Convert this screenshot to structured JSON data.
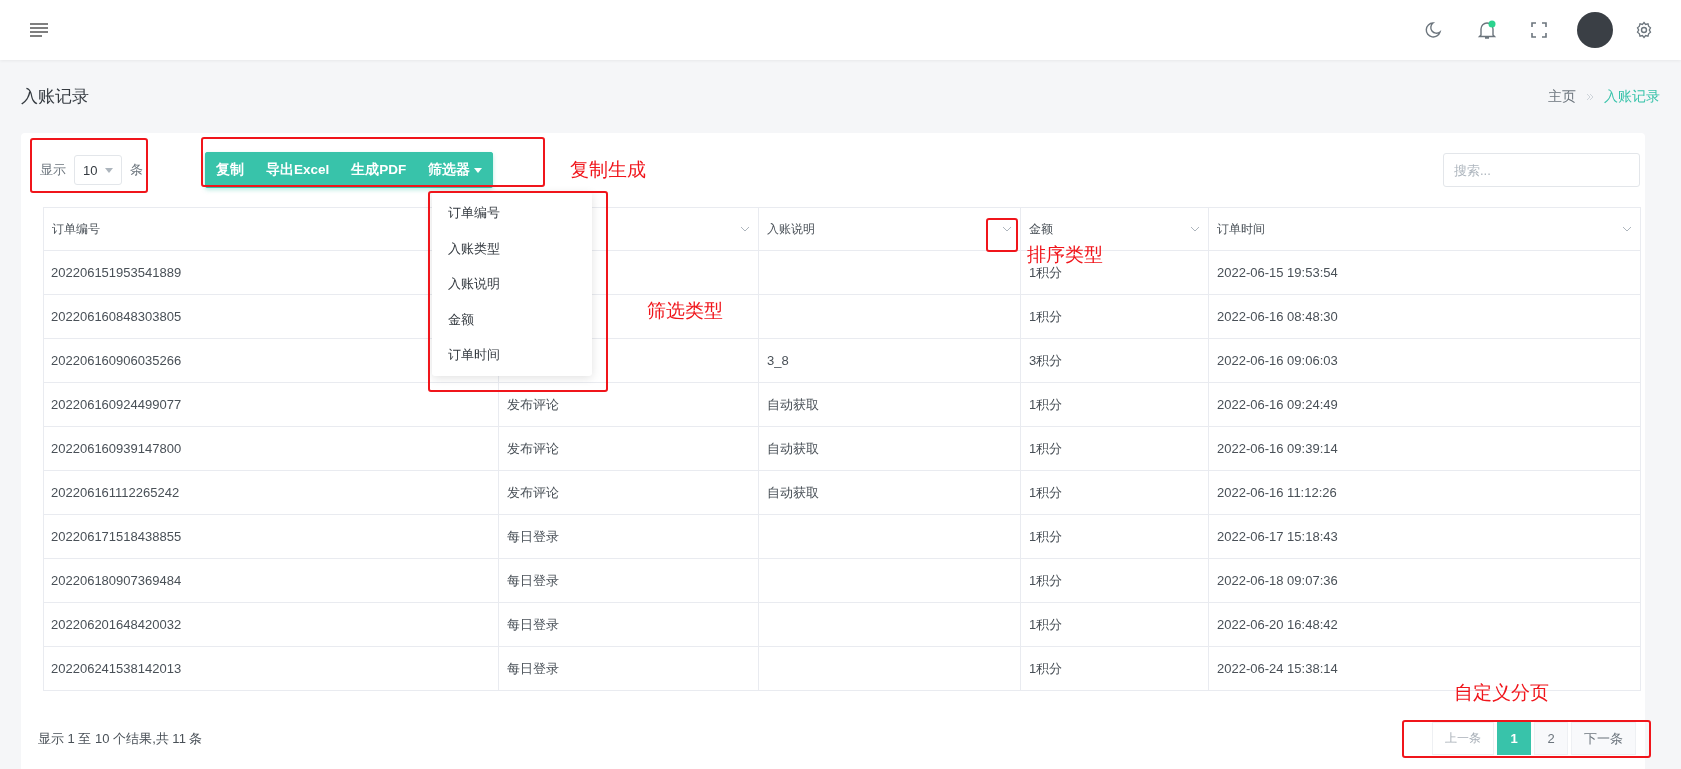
{
  "page_title": "入账记录",
  "breadcrumb": [
    {
      "label": "主页",
      "current": false
    },
    {
      "label": "入账记录",
      "current": true
    }
  ],
  "length_control": {
    "label_before": "显示",
    "value": "10",
    "label_after": "条"
  },
  "toolbar_buttons": [
    {
      "label": "复制",
      "kind": "plain"
    },
    {
      "label": "导出Excel",
      "kind": "plain"
    },
    {
      "label": "生成PDF",
      "kind": "plain"
    },
    {
      "label": "筛选器",
      "kind": "dropdown"
    }
  ],
  "filter_menu": {
    "items": [
      "订单编号",
      "入账类型",
      "入账说明",
      "金额",
      "订单时间"
    ]
  },
  "search": {
    "placeholder": "搜索..."
  },
  "table": {
    "columns": [
      {
        "label": "订单编号",
        "sortable": false
      },
      {
        "sortable": true
      },
      {
        "label": "入账说明",
        "sortable": true
      },
      {
        "label": "金额",
        "sortable": true
      },
      {
        "label": "订单时间",
        "sortable": true
      }
    ],
    "rows": [
      {
        "order_no": "202206151953541889",
        "amount": "1积分",
        "time": "2022-06-15 19:53:54"
      },
      {
        "order_no": "202206160848303805",
        "amount": "1积分",
        "time": "2022-06-16 08:48:30"
      },
      {
        "order_no": "202206160906035266",
        "note": "3_8",
        "amount": "3积分",
        "time": "2022-06-16 09:06:03"
      },
      {
        "order_no": "202206160924499077",
        "type": "发布评论",
        "note": "自动获取",
        "amount": "1积分",
        "time": "2022-06-16 09:24:49"
      },
      {
        "order_no": "202206160939147800",
        "type": "发布评论",
        "note": "自动获取",
        "amount": "1积分",
        "time": "2022-06-16 09:39:14"
      },
      {
        "order_no": "202206161112265242",
        "type": "发布评论",
        "note": "自动获取",
        "amount": "1积分",
        "time": "2022-06-16 11:12:26"
      },
      {
        "order_no": "202206171518438855",
        "type": "每日登录",
        "amount": "1积分",
        "time": "2022-06-17 15:18:43"
      },
      {
        "order_no": "202206180907369484",
        "type": "每日登录",
        "amount": "1积分",
        "time": "2022-06-18 09:07:36"
      },
      {
        "order_no": "202206201648420032",
        "type": "每日登录",
        "amount": "1积分",
        "time": "2022-06-20 16:48:42"
      },
      {
        "order_no": "202206241538142013",
        "type": "每日登录",
        "amount": "1积分",
        "time": "2022-06-24 15:38:14"
      }
    ]
  },
  "table_info": "显示 1 至 10 个结果,共 11 条",
  "pagination": [
    {
      "label": "上一条",
      "selected": false,
      "disabled": true
    },
    {
      "label": "1",
      "selected": true,
      "disabled": false
    },
    {
      "label": "2",
      "selected": false,
      "disabled": false
    },
    {
      "label": "下一条",
      "selected": false,
      "disabled": false
    }
  ],
  "annotations": [
    {
      "text": "复制生成"
    },
    {
      "text": "筛选类型"
    },
    {
      "text": "排序类型"
    },
    {
      "text": "自定义分页"
    }
  ]
}
